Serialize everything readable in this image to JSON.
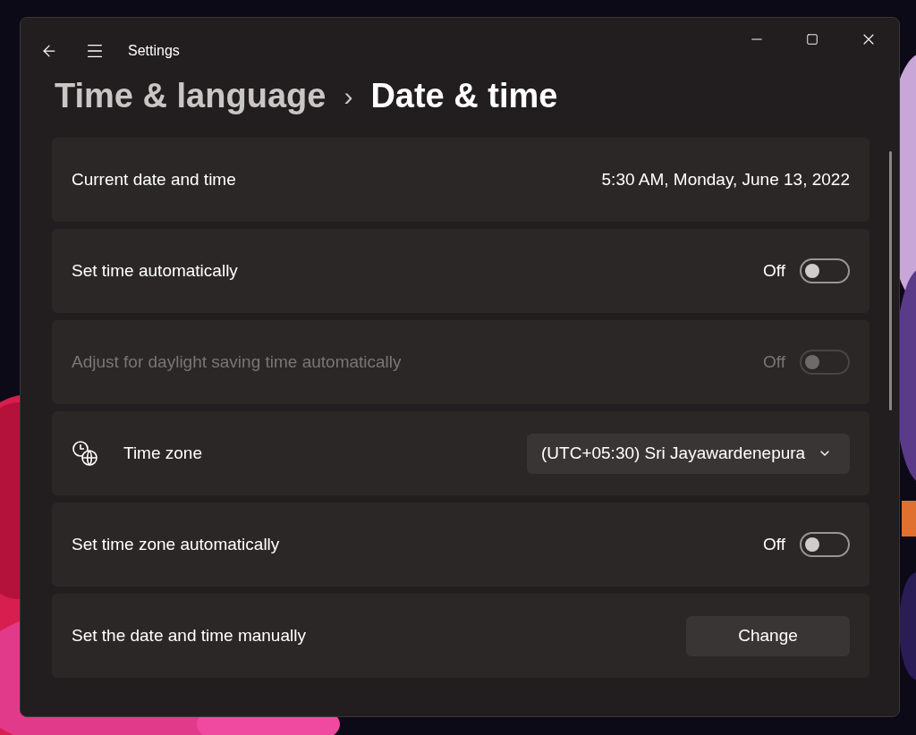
{
  "window": {
    "title": "Settings"
  },
  "breadcrumb": {
    "parent": "Time & language",
    "separator": "›",
    "current": "Date & time"
  },
  "rows": [
    {
      "kind": "value",
      "label": "Current date and time",
      "value": "5:30 AM, Monday, June 13, 2022"
    },
    {
      "kind": "toggle",
      "label": "Set time automatically",
      "state_label": "Off",
      "on": false,
      "disabled": false
    },
    {
      "kind": "toggle",
      "label": "Adjust for daylight saving time automatically",
      "state_label": "Off",
      "on": false,
      "disabled": true
    },
    {
      "kind": "dropdown",
      "label": "Time zone",
      "value": "(UTC+05:30) Sri Jayawardenepura"
    },
    {
      "kind": "toggle",
      "label": "Set time zone automatically",
      "state_label": "Off",
      "on": false,
      "disabled": false
    },
    {
      "kind": "button",
      "label": "Set the date and time manually",
      "button": "Change"
    }
  ]
}
